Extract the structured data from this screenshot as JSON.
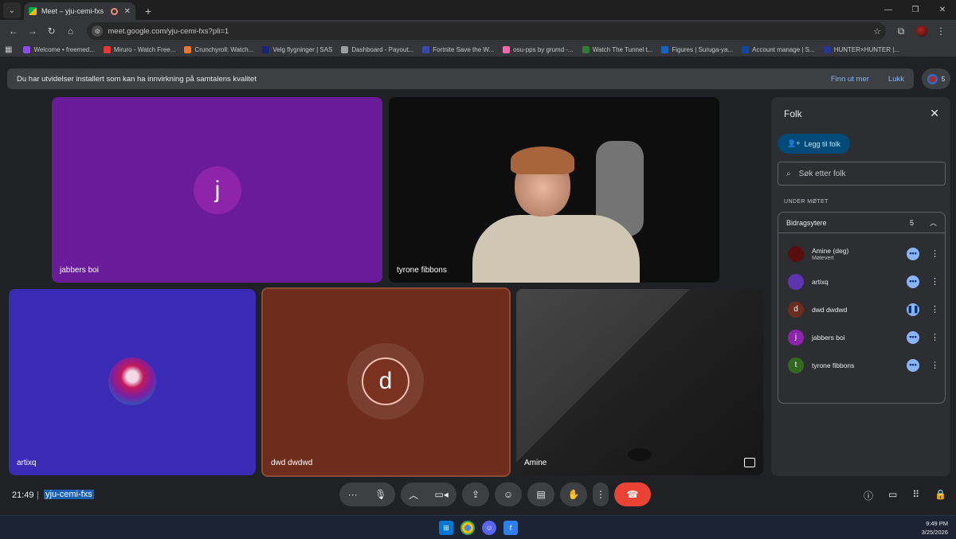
{
  "browser": {
    "tab_title": "Meet – yju-cemi-fxs",
    "url": "meet.google.com/yju-cemi-fxs?pli=1",
    "bookmarks": [
      {
        "label": "Welcome • freemed...",
        "color": "#9146ff"
      },
      {
        "label": "Miruro - Watch Free...",
        "color": "#e53935"
      },
      {
        "label": "Crunchyroll: Watch...",
        "color": "#f47521"
      },
      {
        "label": "Velg flygninger | SAS",
        "color": "#1a237e"
      },
      {
        "label": "Dashboard - Payout...",
        "color": "#9e9e9e"
      },
      {
        "label": "Fortnite Save the W...",
        "color": "#3949ab"
      },
      {
        "label": "osu-pps by grumd -...",
        "color": "#ff66aa"
      },
      {
        "label": "Watch The Tunnel t...",
        "color": "#2e7d32"
      },
      {
        "label": "Figures | Suruga-ya...",
        "color": "#1565c0"
      },
      {
        "label": "Account manage | S...",
        "color": "#0d47a1"
      },
      {
        "label": "HUNTER×HUNTER |...",
        "color": "#283593"
      }
    ]
  },
  "banner": {
    "message": "Du har utvidelser installert som kan ha innvirkning på samtalens kvalitet",
    "learn_more": "Finn ut mer",
    "close": "Lukk",
    "participant_count": "5"
  },
  "tiles": [
    {
      "name": "jabbers boi",
      "initial": "j"
    },
    {
      "name": "tyrone fibbons"
    },
    {
      "name": "artixq"
    },
    {
      "name": "dwd dwdwd",
      "initial": "d"
    },
    {
      "name": "Amine"
    }
  ],
  "panel": {
    "title": "Folk",
    "add_people": "Legg til folk",
    "search_placeholder": "Søk etter folk",
    "section_label": "UNDER MØTET",
    "contributors_label": "Bidragsytere",
    "contributors_count": "5",
    "people": [
      {
        "name": "Amine (deg)",
        "role": "Møtevert",
        "initial": "",
        "color": "#5a0f0f"
      },
      {
        "name": "artixq",
        "role": "",
        "initial": "",
        "color": "#5e35b1"
      },
      {
        "name": "dwd dwdwd",
        "role": "",
        "initial": "d",
        "color": "#6d2d1e"
      },
      {
        "name": "jabbers boi",
        "role": "",
        "initial": "j",
        "color": "#8e24aa"
      },
      {
        "name": "tyrone fibbons",
        "role": "",
        "initial": "t",
        "color": "#33691e"
      }
    ]
  },
  "bottom": {
    "time": "21:49",
    "meeting_code": "yju-cemi-fxs"
  },
  "taskbar": {
    "time": "9:49 PM",
    "date": "3/25/2026"
  }
}
